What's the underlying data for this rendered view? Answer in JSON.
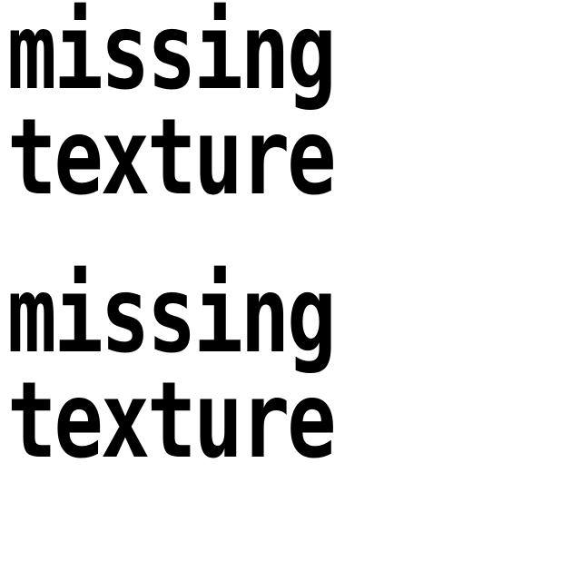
{
  "blocks": [
    {
      "line1": "missing",
      "line2": "texture"
    },
    {
      "line1": "missing",
      "line2": "texture"
    }
  ],
  "colors": {
    "text": "#000000",
    "background": "#ffffff"
  }
}
